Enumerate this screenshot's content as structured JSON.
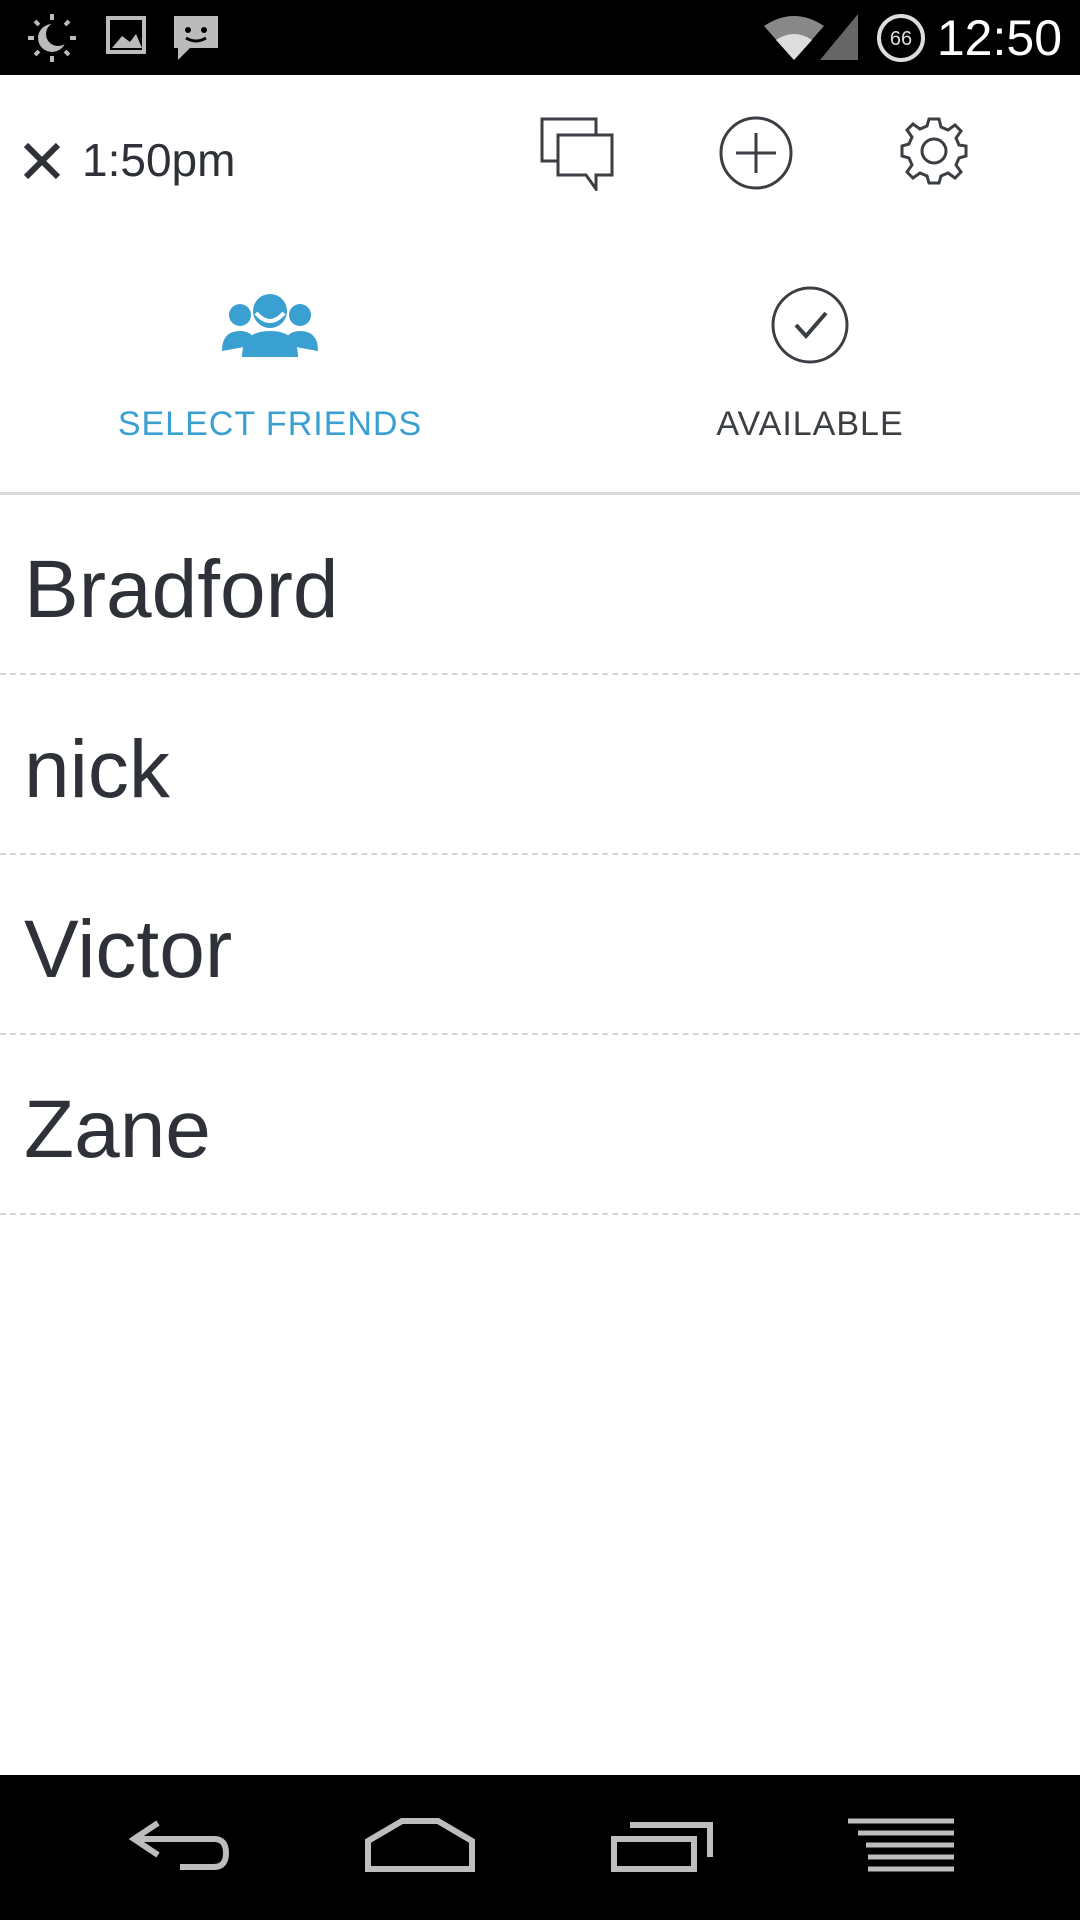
{
  "status_bar": {
    "time": "12:50",
    "battery_level": "66",
    "icons": [
      "brightness-icon",
      "image-icon",
      "chat-notification-icon",
      "wifi-icon",
      "signal-icon",
      "battery-icon"
    ]
  },
  "top_bar": {
    "close_icon": "close-icon",
    "time": "1:50pm",
    "actions": [
      "chat-icon",
      "add-icon",
      "settings-icon"
    ]
  },
  "tabs": [
    {
      "label": "SELECT FRIENDS",
      "icon": "friends-icon",
      "active": true,
      "color": "#3a9fd1"
    },
    {
      "label": "AVAILABLE",
      "icon": "check-circle-icon",
      "active": false,
      "color": "#3b3f44"
    }
  ],
  "friends": [
    "Bradford",
    "nick",
    "Victor",
    "Zane"
  ],
  "nav_bar": [
    "back-icon",
    "home-icon",
    "recents-icon",
    "menu-icon"
  ]
}
